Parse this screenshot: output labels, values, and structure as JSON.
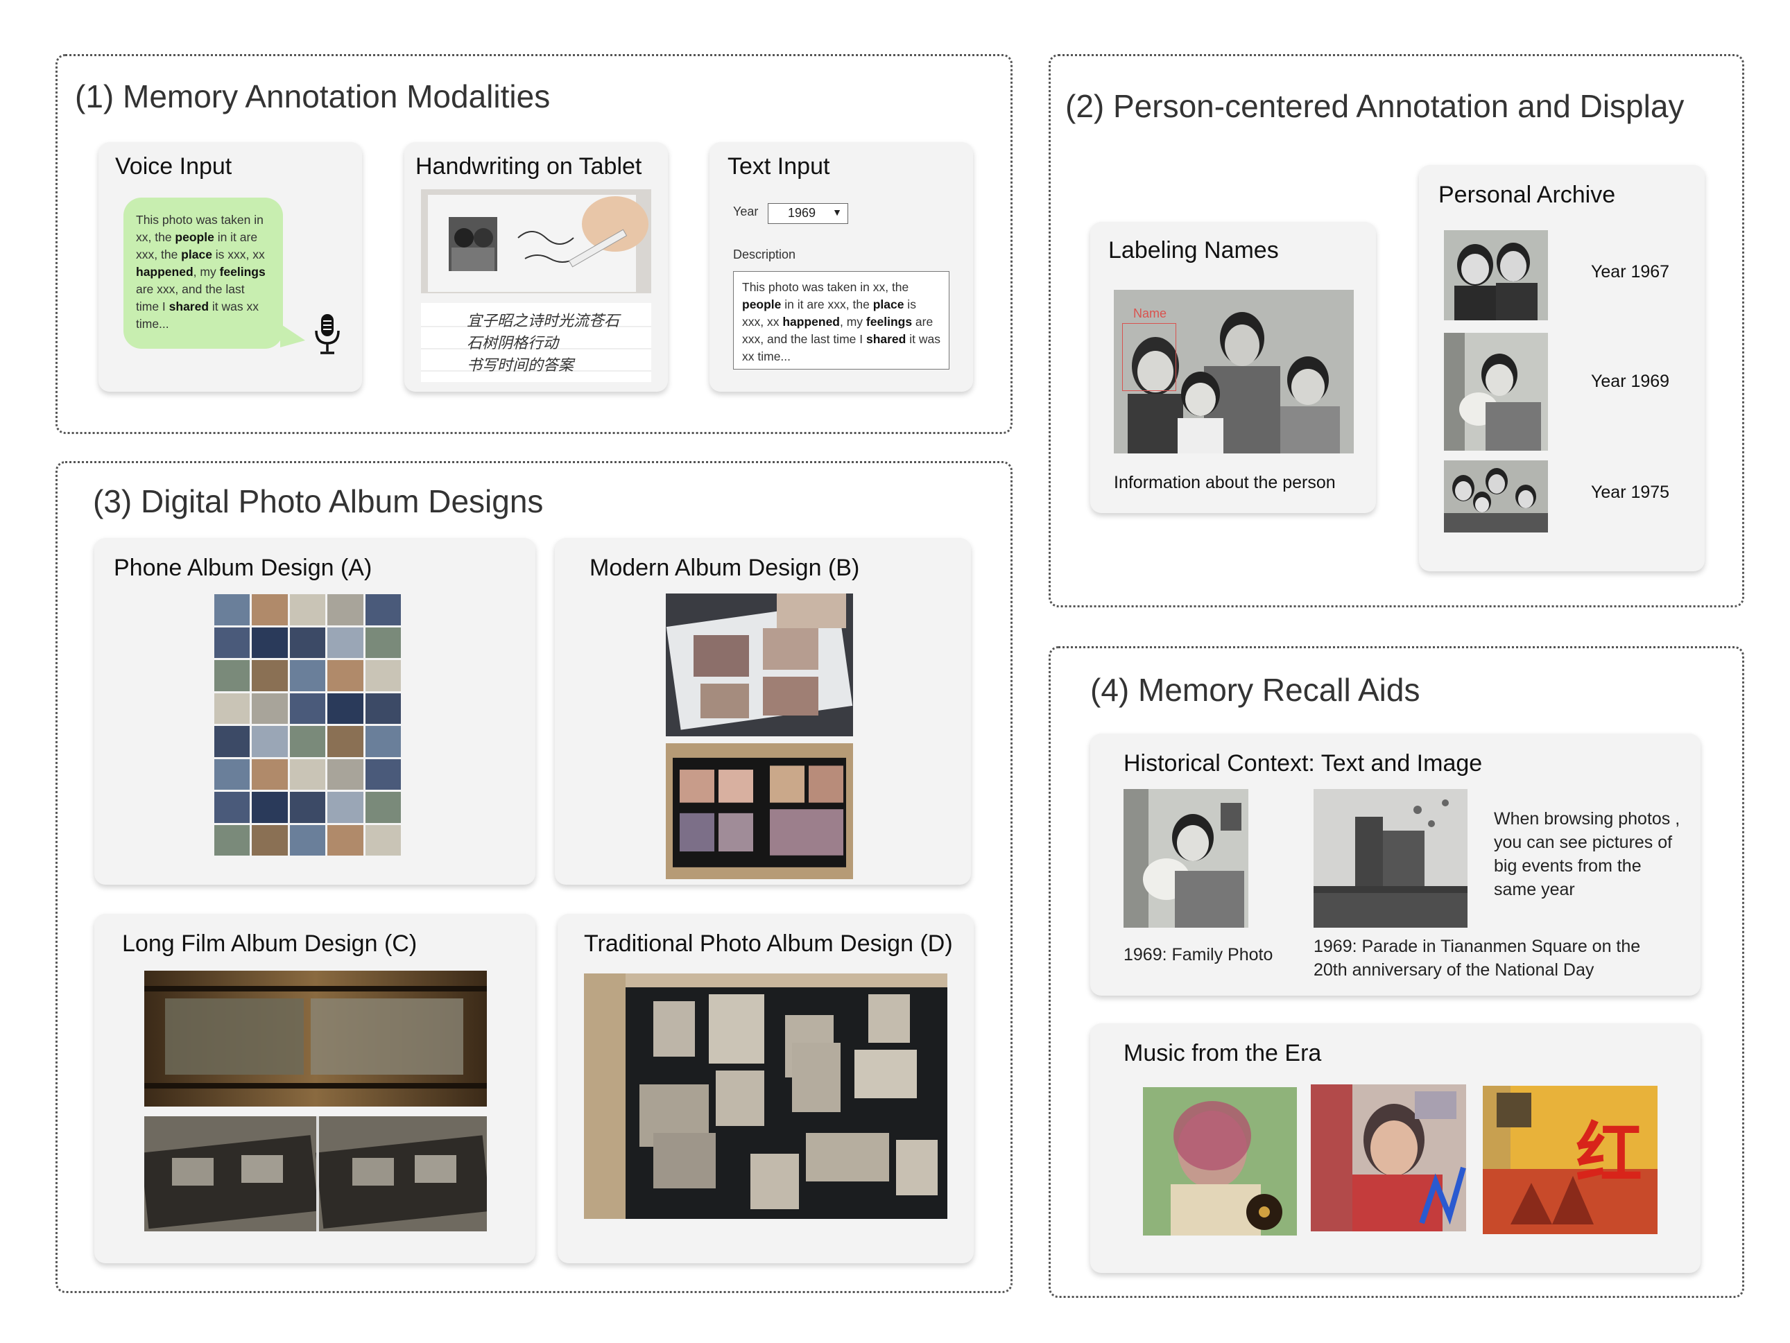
{
  "sections": {
    "s1": {
      "title": "(1) Memory Annotation Modalities",
      "voice": {
        "title": "Voice Input",
        "bubble": [
          {
            "t": "This photo was taken in xx, the "
          },
          {
            "b": "people"
          },
          {
            "t": " in it are xxx, the "
          },
          {
            "b": "place"
          },
          {
            "t": " is xxx, xx "
          },
          {
            "b": "happened"
          },
          {
            "t": ", my "
          },
          {
            "b": "feelings"
          },
          {
            "t": " are xxx, and the last time I "
          },
          {
            "b": "shared"
          },
          {
            "t": " it was xx time..."
          }
        ],
        "icon": "microphone-icon"
      },
      "handwriting": {
        "title": "Handwriting on Tablet",
        "lines": [
          "宜子昭之诗时光流苍石",
          "石树阴格行动",
          "书写时间的答案"
        ]
      },
      "text": {
        "title": "Text Input",
        "year_label": "Year",
        "year_value": "1969",
        "desc_label": "Description",
        "desc": [
          {
            "t": "This photo was taken in xx, the "
          },
          {
            "b": "people"
          },
          {
            "t": " in it are xxx, the "
          },
          {
            "b": "place"
          },
          {
            "t": " is xxx, xx "
          },
          {
            "b": "happened"
          },
          {
            "t": ", my "
          },
          {
            "b": "feelings"
          },
          {
            "t": " are xxx, and the last time I "
          },
          {
            "b": "shared"
          },
          {
            "t": " it was xx time..."
          }
        ]
      }
    },
    "s2": {
      "title": "(2) Person-centered Annotation and Display",
      "labeling": {
        "title": "Labeling Names",
        "name_tag": "Name",
        "info": "Information about the person"
      },
      "archive": {
        "title": "Personal Archive",
        "years": [
          "Year 1967",
          "Year 1969",
          "Year 1975"
        ]
      }
    },
    "s3": {
      "title": "(3) Digital Photo Album Designs",
      "a": "Phone Album Design (A)",
      "b": "Modern Album Design (B)",
      "c": "Long Film Album Design (C)",
      "d": "Traditional Photo Album Design (D)"
    },
    "s4": {
      "title": "(4) Memory Recall Aids",
      "historical": {
        "title": "Historical Context: Text and Image",
        "cap1": "1969: Family Photo",
        "cap2": "1969: Parade in Tiananmen Square on the 20th anniversary of the National Day",
        "note": "When browsing photos , you can see pictures of big events from the same year"
      },
      "music": {
        "title": "Music from the Era",
        "album3_glyph": "红"
      }
    }
  },
  "colors": {
    "bubble": "#c8eeb0",
    "card": "#f3f3f3",
    "border": "#555555",
    "name_box": "#d9534f"
  }
}
